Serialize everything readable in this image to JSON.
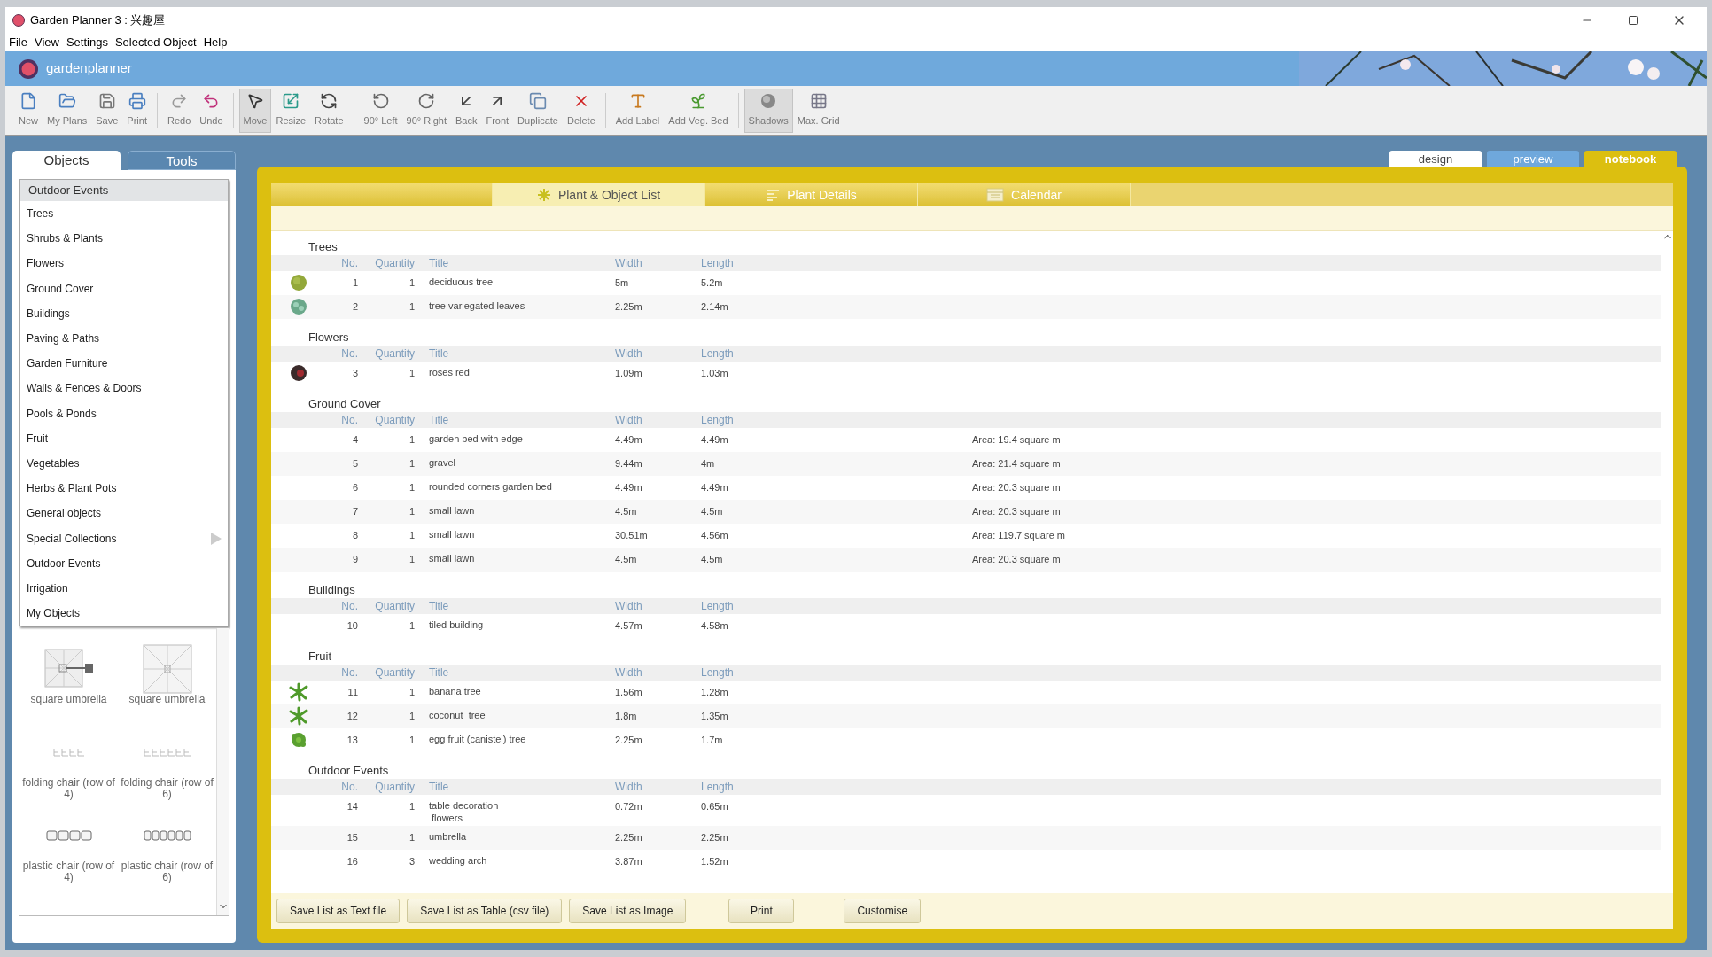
{
  "window": {
    "title": "Garden Planner 3 : 兴趣屋"
  },
  "menu": [
    "File",
    "View",
    "Settings",
    "Selected Object",
    "Help"
  ],
  "banner": {
    "logo": "gardenplanner"
  },
  "toolbar": [
    {
      "label": "New",
      "kind": "new",
      "pressed": false,
      "separator_before": false
    },
    {
      "label": "My Plans",
      "kind": "open",
      "pressed": false,
      "separator_before": false
    },
    {
      "label": "Save",
      "kind": "save",
      "pressed": false,
      "separator_before": false
    },
    {
      "label": "Print",
      "kind": "print",
      "pressed": false,
      "separator_before": false
    },
    {
      "label": "Redo",
      "kind": "redo",
      "pressed": false,
      "separator_before": true
    },
    {
      "label": "Undo",
      "kind": "undo",
      "pressed": false,
      "separator_before": false
    },
    {
      "label": "Move",
      "kind": "move",
      "pressed": true,
      "separator_before": true
    },
    {
      "label": "Resize",
      "kind": "resize",
      "pressed": false,
      "separator_before": false
    },
    {
      "label": "Rotate",
      "kind": "rotate",
      "pressed": false,
      "separator_before": false
    },
    {
      "label": "90° Left",
      "kind": "left",
      "pressed": false,
      "separator_before": true
    },
    {
      "label": "90° Right",
      "kind": "right",
      "pressed": false,
      "separator_before": false
    },
    {
      "label": "Back",
      "kind": "back",
      "pressed": false,
      "separator_before": false
    },
    {
      "label": "Front",
      "kind": "front",
      "pressed": false,
      "separator_before": false
    },
    {
      "label": "Duplicate",
      "kind": "duplicate",
      "pressed": false,
      "separator_before": false
    },
    {
      "label": "Delete",
      "kind": "delete",
      "pressed": false,
      "separator_before": false
    },
    {
      "label": "Add Label",
      "kind": "label",
      "pressed": false,
      "separator_before": true
    },
    {
      "label": "Add Veg. Bed",
      "kind": "veg",
      "pressed": false,
      "separator_before": false
    },
    {
      "label": "Shadows",
      "kind": "shadows",
      "pressed": true,
      "separator_before": true
    },
    {
      "label": "Max. Grid",
      "kind": "grid",
      "pressed": false,
      "separator_before": false
    }
  ],
  "view_tabs": [
    {
      "label": "design",
      "selected": false,
      "color": "#ffffff"
    },
    {
      "label": "preview",
      "selected": false,
      "color": "#6fa8dc"
    },
    {
      "label": "notebook",
      "selected": true,
      "color": "#dcbf10"
    }
  ],
  "sidebar": {
    "tabs": [
      {
        "label": "Objects",
        "selected": true
      },
      {
        "label": "Tools",
        "selected": false
      }
    ],
    "category": "Outdoor Events",
    "items": [
      {
        "label": "Trees",
        "submenu": false
      },
      {
        "label": "Shrubs & Plants",
        "submenu": false
      },
      {
        "label": "Flowers",
        "submenu": false
      },
      {
        "label": "Ground Cover",
        "submenu": false
      },
      {
        "label": "Buildings",
        "submenu": false
      },
      {
        "label": "Paving & Paths",
        "submenu": false
      },
      {
        "label": "Garden Furniture",
        "submenu": false
      },
      {
        "label": "Walls & Fences & Doors",
        "submenu": false
      },
      {
        "label": "Pools & Ponds",
        "submenu": false
      },
      {
        "label": "Fruit",
        "submenu": false
      },
      {
        "label": "Vegetables",
        "submenu": false
      },
      {
        "label": "Herbs & Plant Pots",
        "submenu": false
      },
      {
        "label": "General objects",
        "submenu": false
      },
      {
        "label": "Special Collections",
        "submenu": true
      },
      {
        "label": "Outdoor Events",
        "submenu": false
      },
      {
        "label": "Irrigation",
        "submenu": false
      },
      {
        "label": "My Objects",
        "submenu": false
      }
    ],
    "objects": [
      {
        "label": "square umbrella",
        "kind": "umbrella-stand"
      },
      {
        "label": "square umbrella",
        "kind": "umbrella"
      },
      {
        "label": "folding chair (row of 4)",
        "kind": "folding-4"
      },
      {
        "label": "folding chair (row of 6)",
        "kind": "folding-6"
      },
      {
        "label": "plastic chair (row of 4)",
        "kind": "plastic-4"
      },
      {
        "label": "plastic chair (row of 6)",
        "kind": "plastic-6"
      }
    ]
  },
  "notebook": {
    "tabs": [
      {
        "label": "Plant & Object List",
        "kind": "star",
        "selected": true
      },
      {
        "label": "Plant Details",
        "kind": "lines",
        "selected": false
      },
      {
        "label": "Calendar",
        "kind": "calendar",
        "selected": false
      }
    ],
    "sections": [
      {
        "title": "Trees",
        "columns": [
          "No.",
          "Quantity",
          "Title",
          "Width",
          "Length"
        ],
        "rows": [
          {
            "no": "1",
            "quantity": "1",
            "title": "deciduous tree",
            "width": "5m",
            "length": "5.2m",
            "kind": "round"
          },
          {
            "no": "2",
            "quantity": "1",
            "title": "tree variegated leaves",
            "width": "2.25m",
            "length": "2.14m",
            "kind": "variegated"
          }
        ]
      },
      {
        "title": "Flowers",
        "columns": [
          "No.",
          "Quantity",
          "Title",
          "Width",
          "Length"
        ],
        "rows": [
          {
            "no": "3",
            "quantity": "1",
            "title": "roses red",
            "width": "1.09m",
            "length": "1.03m",
            "kind": "rose"
          }
        ]
      },
      {
        "title": "Ground Cover",
        "columns": [
          "No.",
          "Quantity",
          "Title",
          "Width",
          "Length"
        ],
        "rows": [
          {
            "no": "4",
            "quantity": "1",
            "title": "garden bed with edge",
            "width": "4.49m",
            "length": "4.49m",
            "area": "Area: 19.4 square m",
            "kind": "none"
          },
          {
            "no": "5",
            "quantity": "1",
            "title": "gravel",
            "width": "9.44m",
            "length": "4m",
            "area": "Area: 21.4 square m",
            "kind": "none"
          },
          {
            "no": "6",
            "quantity": "1",
            "title": "rounded corners garden bed",
            "width": "4.49m",
            "length": "4.49m",
            "area": "Area: 20.3 square m",
            "kind": "none"
          },
          {
            "no": "7",
            "quantity": "1",
            "title": "small lawn",
            "width": "4.5m",
            "length": "4.5m",
            "area": "Area: 20.3 square m",
            "kind": "none"
          },
          {
            "no": "8",
            "quantity": "1",
            "title": "small lawn",
            "width": "30.51m",
            "length": "4.56m",
            "area": "Area: 119.7 square m",
            "kind": "none"
          },
          {
            "no": "9",
            "quantity": "1",
            "title": "small lawn",
            "width": "4.5m",
            "length": "4.5m",
            "area": "Area: 20.3 square m",
            "kind": "none"
          }
        ]
      },
      {
        "title": "Buildings",
        "columns": [
          "No.",
          "Quantity",
          "Title",
          "Width",
          "Length"
        ],
        "rows": [
          {
            "no": "10",
            "quantity": "1",
            "title": "tiled building",
            "width": "4.57m",
            "length": "4.58m",
            "kind": "none"
          }
        ]
      },
      {
        "title": "Fruit",
        "columns": [
          "No.",
          "Quantity",
          "Title",
          "Width",
          "Length"
        ],
        "rows": [
          {
            "no": "11",
            "quantity": "1",
            "title": "banana tree",
            "width": "1.56m",
            "length": "1.28m",
            "kind": "palm"
          },
          {
            "no": "12",
            "quantity": "1",
            "title": "coconut  tree",
            "width": "1.8m",
            "length": "1.35m",
            "kind": "palm"
          },
          {
            "no": "13",
            "quantity": "1",
            "title": "egg fruit (canistel) tree",
            "width": "2.25m",
            "length": "1.7m",
            "kind": "leafy"
          }
        ]
      },
      {
        "title": "Outdoor Events",
        "columns": [
          "No.",
          "Quantity",
          "Title",
          "Width",
          "Length"
        ],
        "rows": [
          {
            "no": "14",
            "quantity": "1",
            "title": "table decoration\n flowers",
            "width": "0.72m",
            "length": "0.65m",
            "kind": "none"
          },
          {
            "no": "15",
            "quantity": "1",
            "title": "umbrella",
            "width": "2.25m",
            "length": "2.25m",
            "kind": "none"
          },
          {
            "no": "16",
            "quantity": "3",
            "title": "wedding arch",
            "width": "3.87m",
            "length": "1.52m",
            "kind": "none"
          }
        ]
      }
    ],
    "buttons": [
      "Save List as Text file",
      "Save List as Table (csv file)",
      "Save List as Image",
      "Print",
      "Customise"
    ]
  }
}
